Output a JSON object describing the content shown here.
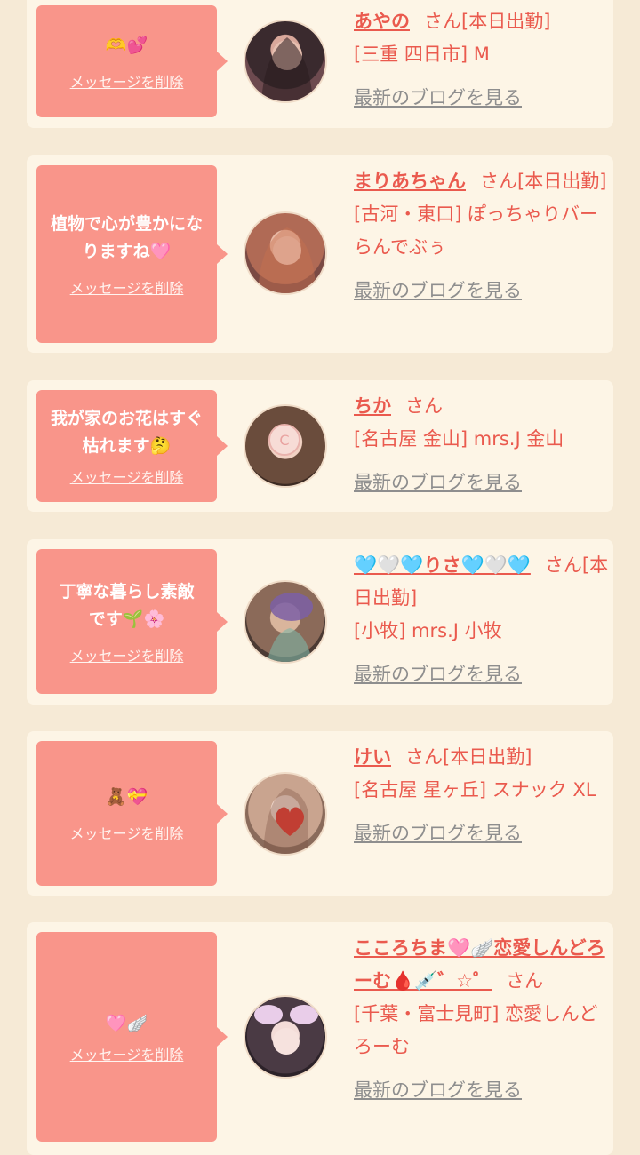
{
  "colors": {
    "page_bg": "#f6ead6",
    "card_bg": "#fdf5e6",
    "bubble_bg": "#f9958a",
    "accent_text": "#ea5a4e",
    "link_gray": "#8e8e8e"
  },
  "common": {
    "delete_label": "メッセージを削除",
    "blog_label": "最新のブログを見る"
  },
  "entries": [
    {
      "message": "🫶💕",
      "name": "あやの",
      "suffix": "さん[本日出勤]",
      "shop": "[三重 四日市] M"
    },
    {
      "message": "植物で心が豊かになりますね🩷",
      "name": "まりあちゃん",
      "suffix": "さん[本日出勤]",
      "shop": "[古河・東口] ぽっちゃりバー らんでぶぅ"
    },
    {
      "message": "我が家のお花はすぐ枯れます🤔",
      "name": "ちか",
      "suffix": "さん",
      "shop": "[名古屋 金山] mrs.J 金山"
    },
    {
      "message": "丁寧な暮らし素敵です🌱🌸",
      "name": "🩵🤍🩵りさ🩵🤍🩵",
      "suffix": "さん[本日出勤]",
      "shop": "[小牧] mrs.J 小牧"
    },
    {
      "message": "🧸💝",
      "name": "けい",
      "suffix": "さん[本日出勤]",
      "shop": "[名古屋 星ヶ丘] スナック XL"
    },
    {
      "message": "🩷🪽",
      "name": "こころちま🩷🪽恋愛しんどろーむ🩸💉゛☆゜",
      "suffix": "さん",
      "shop": "[千葉・富士見町] 恋愛しんどろーむ"
    }
  ]
}
